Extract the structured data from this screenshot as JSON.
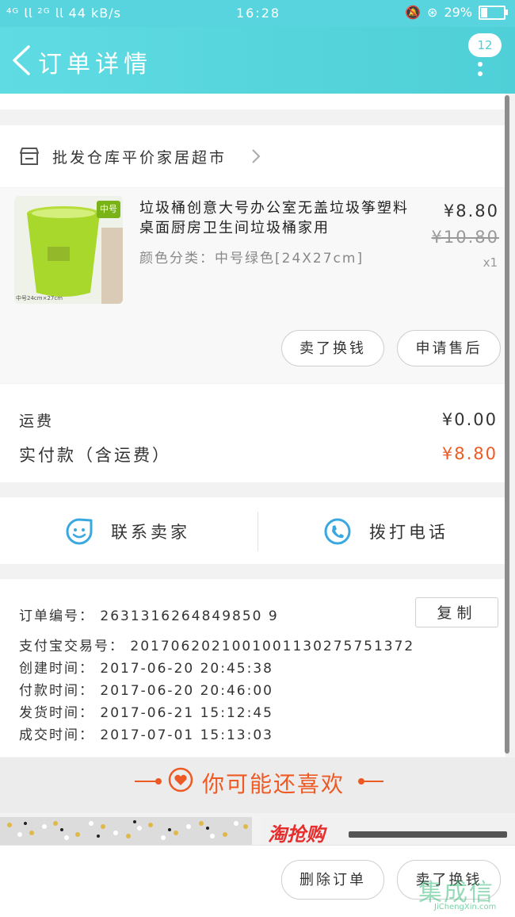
{
  "status_bar": {
    "signal_left": "⁴ᴳ 𝗅𝗅 ²ᴳ 𝗅𝗅 44 kB/s",
    "time": "16:28",
    "battery": "29%"
  },
  "header": {
    "title": "订单详情",
    "badge_count": "12"
  },
  "shop": {
    "name": "批发仓库平价家居超市"
  },
  "product": {
    "image_tag": "中号",
    "image_caption": "中号24cm×27cm",
    "title": "垃圾桶创意大号办公室无盖垃圾筝塑料桌面厨房卫生间垃圾桶家用",
    "sku": "颜色分类：中号绿色[24X27cm]",
    "price": "¥8.80",
    "original_price": "¥10.80",
    "quantity": "x1"
  },
  "actions": {
    "sell_button": "卖了换钱",
    "after_sale_button": "申请售后"
  },
  "fees": {
    "shipping_label": "运费",
    "shipping_value": "¥0.00",
    "paid_label": "实付款（含运费）",
    "paid_value": "¥8.80"
  },
  "contact": {
    "seller_label": "联系卖家",
    "call_label": "拨打电话"
  },
  "order_info": {
    "order_no": "订单编号： 2631316264849850 9",
    "copy_button": "复制",
    "alipay_no": "支付宝交易号： 2017062021001001130275751372",
    "created": "创建时间： 2017-06-20 20:45:38",
    "paid": "付款时间： 2017-06-20 20:46:00",
    "shipped": "发货时间： 2017-06-21 15:12:45",
    "completed": "成交时间： 2017-07-01 15:13:03"
  },
  "recommend": {
    "title": "你可能还喜欢",
    "banner_right_text": "淘抢购"
  },
  "bottom": {
    "delete_button": "删除订单",
    "sell_button": "卖了换钱"
  },
  "watermark": {
    "text": "集成信",
    "sub": "JiChengXin.com"
  },
  "colors": {
    "header": "#4fcfd7",
    "accent_orange": "#ee5a24",
    "icon_blue": "#3aa8e0"
  }
}
